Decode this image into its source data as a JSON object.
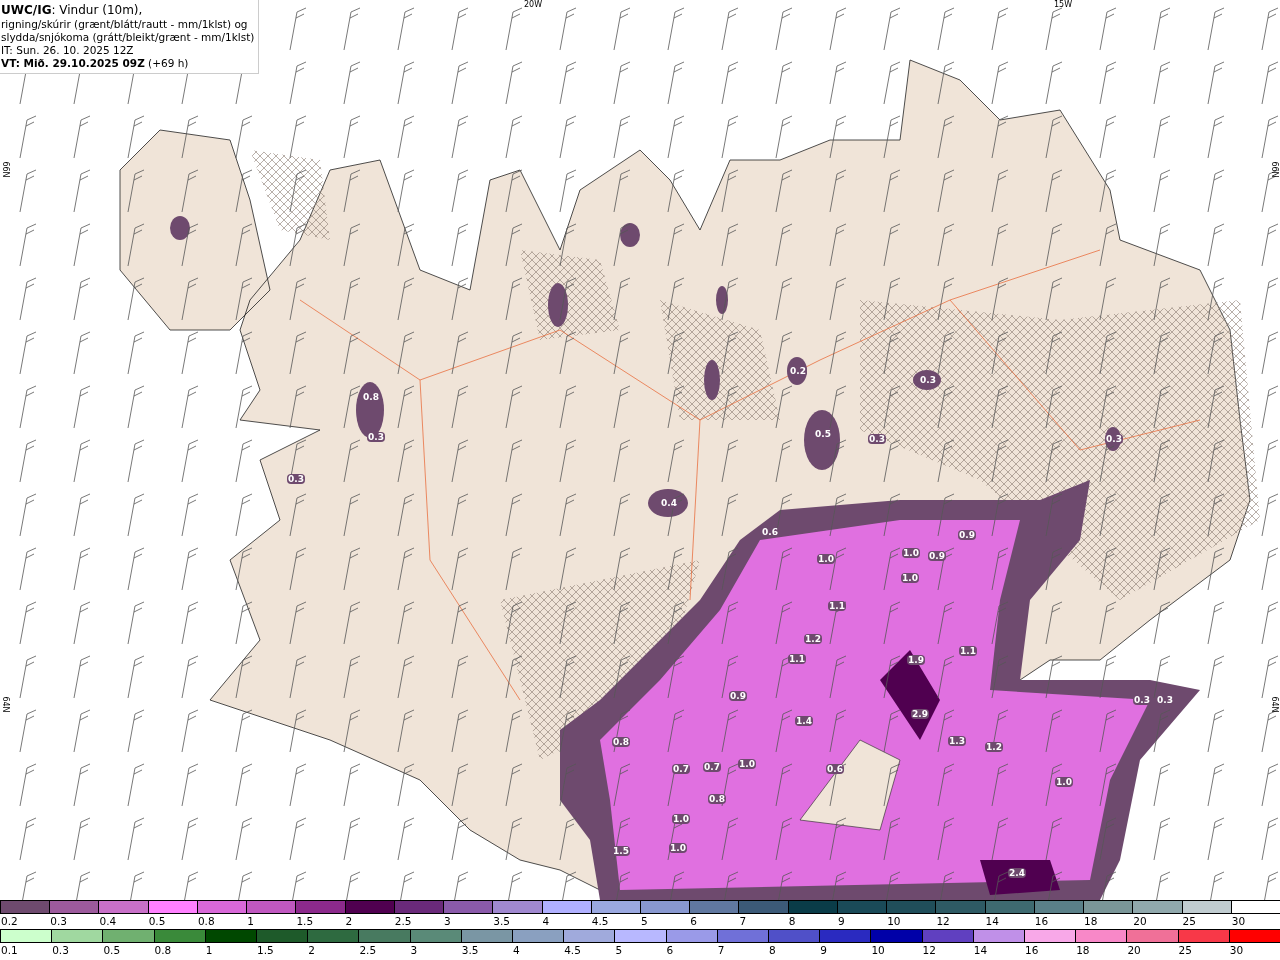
{
  "header": {
    "lines": [
      "**UWC/IG**: Vindur (10m),",
      "rigning/skúrir (grænt/blátt/rautt - mm/1klst) og",
      "slydda/snjókoma (grátt/bleikt/grænt - mm/1klst)",
      "IT: Sun. 26. 10. 2025 12Z",
      "**VT: Mið. 29.10.2025 09Z** (+69 h)"
    ]
  },
  "map": {
    "longitude_labels": [
      "20W",
      "15W"
    ],
    "latitude_labels_left": [
      "66N",
      "64N"
    ],
    "latitude_labels_right": [
      "66N",
      "64N"
    ],
    "value_labels": [
      "0.8",
      "0.3",
      "0.3",
      "0.4",
      "0.2",
      "0.3",
      "0.5",
      "0.3",
      "0.3",
      "0.6",
      "1.0",
      "0.9",
      "1.0",
      "0.9",
      "1.0",
      "1.1",
      "1.2",
      "1.1",
      "1.9",
      "1.1",
      "0.9",
      "1.4",
      "2.9",
      "1.3",
      "1.2",
      "0.3",
      "0.3",
      "0.8",
      "0.7",
      "0.7",
      "1.0",
      "0.6",
      "1.0",
      "0.8",
      "1.0",
      "1.0",
      "1.5",
      "2.4"
    ]
  },
  "legend": {
    "snow_scale": [
      {
        "label": "0.2",
        "color": "#6e4a6e"
      },
      {
        "label": "0.3",
        "color": "#9c5a9c"
      },
      {
        "label": "0.4",
        "color": "#c870c8"
      },
      {
        "label": "0.5",
        "color": "#ff80ff"
      },
      {
        "label": "0.8",
        "color": "#d868d8"
      },
      {
        "label": "1",
        "color": "#c058c0"
      },
      {
        "label": "1.5",
        "color": "#8c2a8c"
      },
      {
        "label": "2",
        "color": "#500050"
      },
      {
        "label": "2.5",
        "color": "#6a2a7a"
      },
      {
        "label": "3",
        "color": "#8a5aaa"
      },
      {
        "label": "3.5",
        "color": "#a088d0"
      },
      {
        "label": "4",
        "color": "#b0b0ff"
      },
      {
        "label": "4.5",
        "color": "#9aa8e0"
      },
      {
        "label": "5",
        "color": "#8898d0"
      },
      {
        "label": "6",
        "color": "#6078a0"
      },
      {
        "label": "7",
        "color": "#3c5a78"
      },
      {
        "label": "8",
        "color": "#0a3c48"
      },
      {
        "label": "9",
        "color": "#1a4a58"
      },
      {
        "label": "10",
        "color": "#204e5a"
      },
      {
        "label": "12",
        "color": "#2e5a64"
      },
      {
        "label": "14",
        "color": "#3e6a70"
      },
      {
        "label": "16",
        "color": "#5a8088"
      },
      {
        "label": "18",
        "color": "#7a9698"
      },
      {
        "label": "20",
        "color": "#90a8ac"
      },
      {
        "label": "25",
        "color": "#c0ccd0"
      },
      {
        "label": "30",
        "color": "#ffffff"
      }
    ],
    "rain_scale": [
      {
        "label": "0.1",
        "color": "#ccffcc"
      },
      {
        "label": "0.3",
        "color": "#a0d8a0"
      },
      {
        "label": "0.5",
        "color": "#70b070"
      },
      {
        "label": "0.8",
        "color": "#3a8a3a"
      },
      {
        "label": "1",
        "color": "#004800"
      },
      {
        "label": "1.5",
        "color": "#1e5a2a"
      },
      {
        "label": "2",
        "color": "#2e6a40"
      },
      {
        "label": "2.5",
        "color": "#487a60"
      },
      {
        "label": "3",
        "color": "#5a8a78"
      },
      {
        "label": "3.5",
        "color": "#7a96a4"
      },
      {
        "label": "4",
        "color": "#8aa0c0"
      },
      {
        "label": "4.5",
        "color": "#a0aadc"
      },
      {
        "label": "5",
        "color": "#b8b8ff"
      },
      {
        "label": "6",
        "color": "#9a9ae8"
      },
      {
        "label": "7",
        "color": "#7070d8"
      },
      {
        "label": "8",
        "color": "#5050c8"
      },
      {
        "label": "9",
        "color": "#2a2ac0"
      },
      {
        "label": "10",
        "color": "#0000a8"
      },
      {
        "label": "12",
        "color": "#6040c0"
      },
      {
        "label": "14",
        "color": "#c090e8"
      },
      {
        "label": "16",
        "color": "#f8a8e8"
      },
      {
        "label": "18",
        "color": "#f888c8"
      },
      {
        "label": "20",
        "color": "#f07098"
      },
      {
        "label": "25",
        "color": "#f83848"
      },
      {
        "label": "30",
        "color": "#ff0000"
      }
    ]
  }
}
